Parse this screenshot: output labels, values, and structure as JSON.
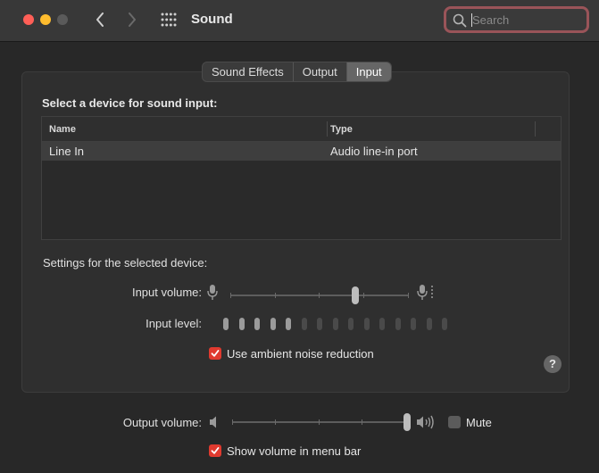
{
  "window": {
    "title": "Sound"
  },
  "search": {
    "placeholder": "Search"
  },
  "tabs": [
    {
      "label": "Sound Effects",
      "active": false
    },
    {
      "label": "Output",
      "active": false
    },
    {
      "label": "Input",
      "active": true
    }
  ],
  "input": {
    "section_label": "Select a device for sound input:",
    "table": {
      "columns": [
        "Name",
        "Type"
      ],
      "rows": [
        {
          "name": "Line In",
          "type": "Audio line-in port"
        }
      ]
    },
    "settings_label": "Settings for the selected device:",
    "input_volume_label": "Input volume:",
    "input_volume_value": 0.7,
    "input_level_label": "Input level:",
    "input_level_active_bars": 5,
    "input_level_total_bars": 15,
    "ambient_noise_label": "Use ambient noise reduction",
    "ambient_noise_checked": true
  },
  "output": {
    "volume_label": "Output volume:",
    "volume_value": 1.0,
    "mute_label": "Mute",
    "mute_checked": false,
    "show_volume_label": "Show volume in menu bar",
    "show_volume_checked": true
  },
  "colors": {
    "accent": "#e03a2f",
    "search_focus": "#9a5459"
  }
}
